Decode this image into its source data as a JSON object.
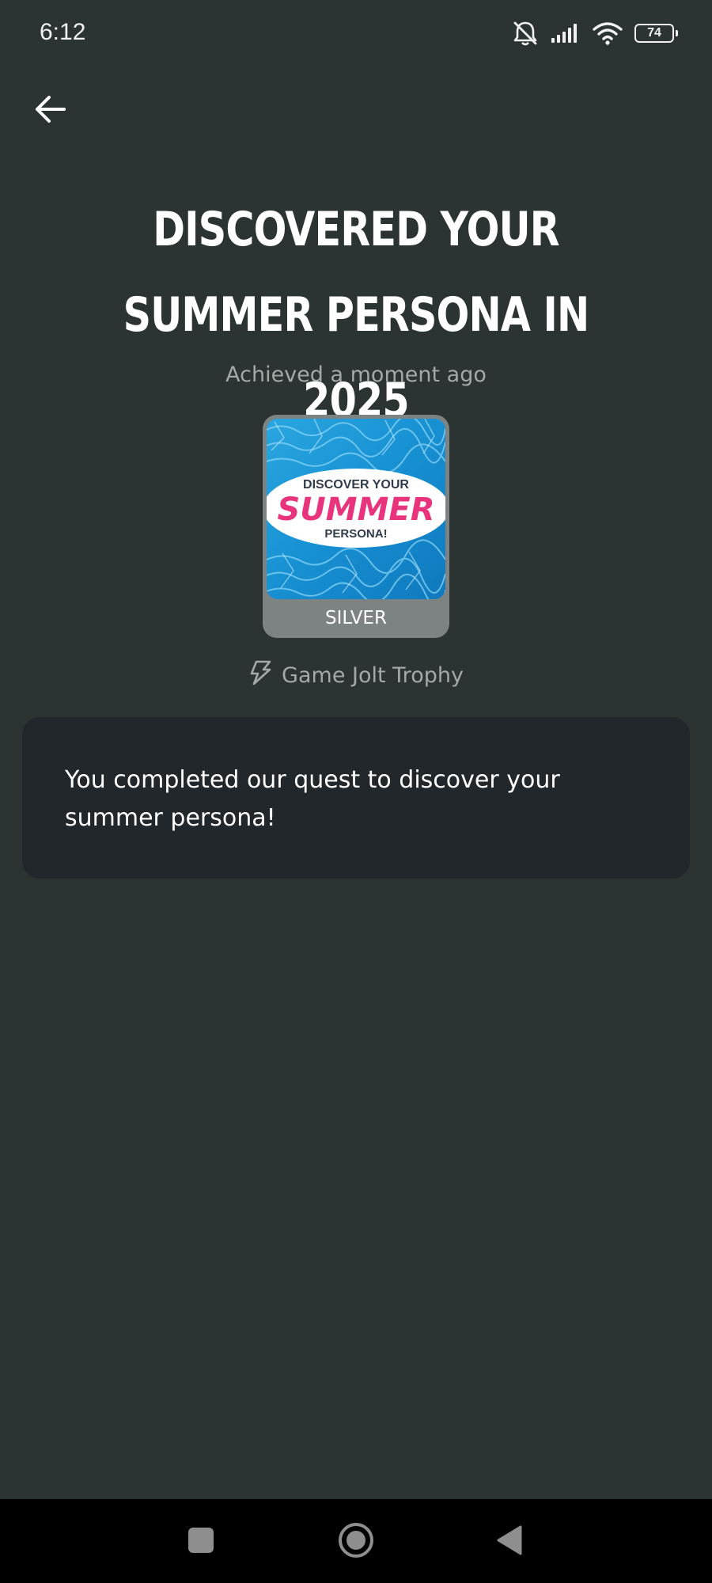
{
  "status_bar": {
    "time": "6:12",
    "battery_level": "74",
    "icons": [
      "bell-muted-icon",
      "signal-icon",
      "wifi-icon",
      "battery-icon"
    ]
  },
  "header": {
    "back_icon": "arrow-left-icon"
  },
  "trophy": {
    "title": "DISCOVERED YOUR SUMMER PERSONA IN 2025",
    "achieved": "Achieved a moment ago",
    "image_text": {
      "line1": "DISCOVER YOUR",
      "line2": "SUMMER",
      "line3": "PERSONA!"
    },
    "tier": "SILVER",
    "type_icon": "game-jolt-bolt-icon",
    "type_label": "Game Jolt Trophy",
    "description": "You completed our quest to discover your summer persona!"
  },
  "colors": {
    "background": "#2b3432",
    "card": "#22272b",
    "muted_text": "#a4a9a8",
    "silver_frame": "#7d8382",
    "summer_pink": "#e8347c"
  },
  "nav": {
    "icons": [
      "recents-square-icon",
      "home-circle-icon",
      "back-triangle-icon"
    ]
  }
}
